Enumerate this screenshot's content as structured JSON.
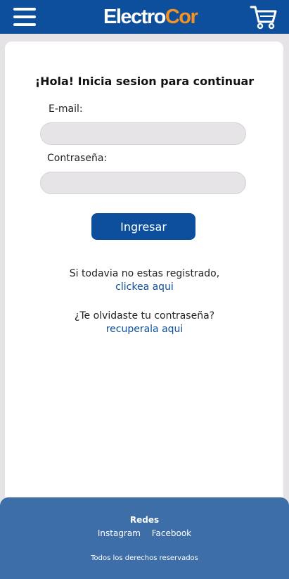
{
  "header": {
    "logo_part1": "Electro",
    "logo_part2": "Cor",
    "menu_icon": "hamburger-menu-icon",
    "cart_icon": "shopping-cart-icon",
    "bar_color": "#0d4f9c",
    "accent_color": "#f39223"
  },
  "login": {
    "heading": "¡Hola! Inicia sesion para continuar",
    "email_label": "E-mail:",
    "email_value": "",
    "password_label": "Contraseña:",
    "password_value": "",
    "submit_label": "Ingresar",
    "register_text": "Si todavia no estas registrado,",
    "register_link": "clickea aqui",
    "forgot_text": "¿Te olvidaste tu contraseña?",
    "forgot_link": "recuperala aqui"
  },
  "footer": {
    "title": "Redes",
    "links": [
      "Instagram",
      "Facebook"
    ],
    "copyright": "Todos los derechos reservados",
    "bg_color": "#3d6ea7"
  }
}
